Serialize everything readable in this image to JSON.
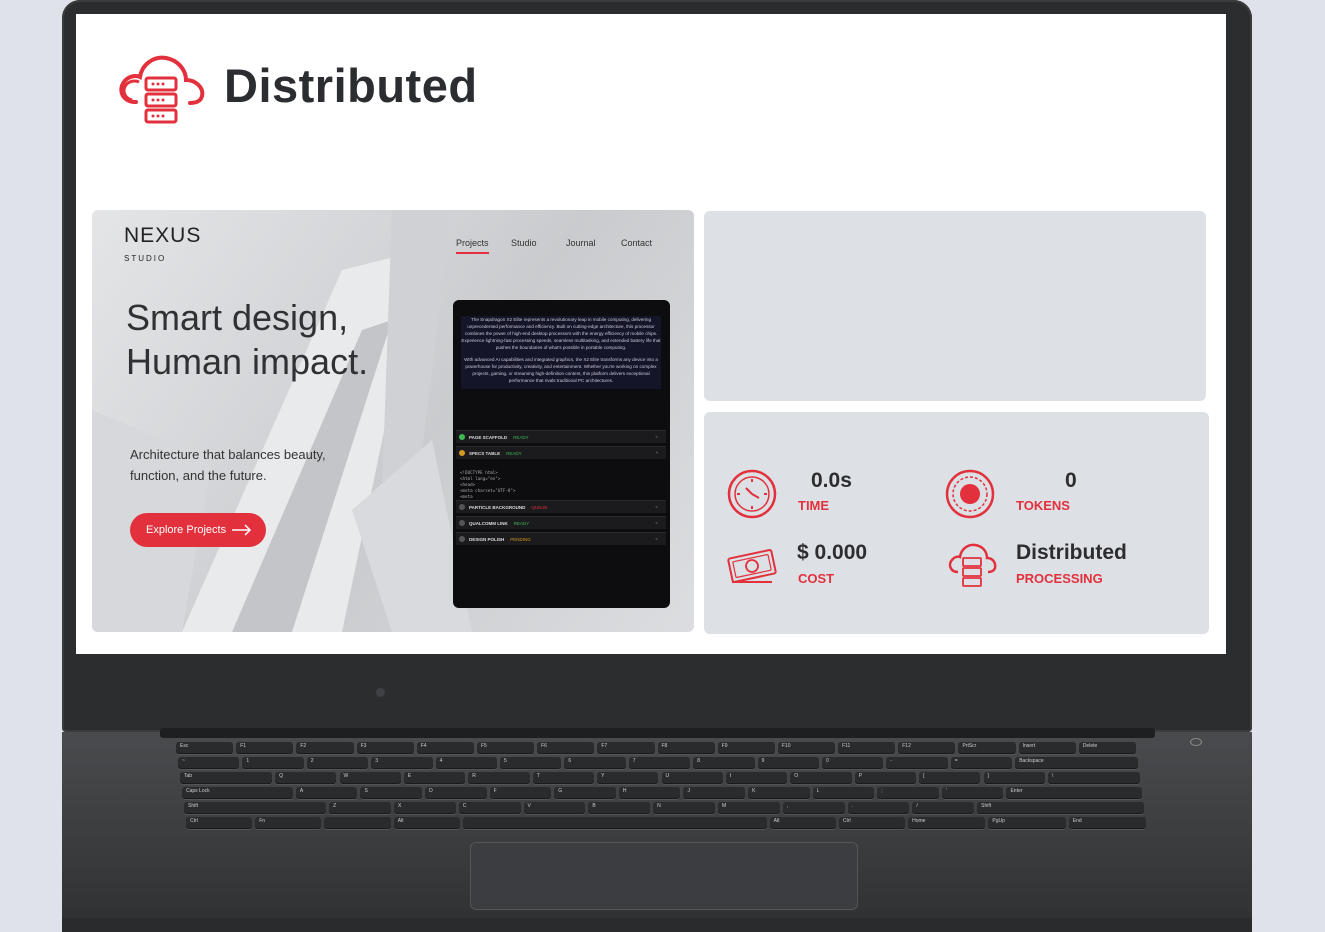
{
  "header": {
    "title": "Distributed",
    "icon": "cloud-server-icon"
  },
  "preview": {
    "brand_name": "NEXUS",
    "brand_sub": "STUDIO",
    "nav": [
      "Projects",
      "Studio",
      "Journal",
      "Contact"
    ],
    "active_nav": "Projects",
    "hero_line1": "Smart design,",
    "hero_line2": "Human impact.",
    "tagline": "Architecture that balances beauty, function, and the future.",
    "cta_label": "Explore Projects",
    "mock": {
      "para1": "The Snapdragon X2 Elite represents a revolutionary leap in mobile computing, delivering unprecedented performance and efficiency. Built on cutting-edge architecture, this processor combines the power of high-end desktop processors with the energy efficiency of mobile chips. Experience lightning-fast processing speeds, seamless multitasking, and extended battery life that pushes the boundaries of what's possible in portable computing.",
      "para2": "With advanced AI capabilities and integrated graphics, the X2 Elite transforms any device into a powerhouse for productivity, creativity, and entertainment. Whether you're working on complex projects, gaming, or streaming high-definition content, this platform delivers exceptional performance that rivals traditional PC architectures.",
      "rows": [
        {
          "label": "PAGE SCAFFOLD",
          "status": "READY",
          "status_color": "#3fb950",
          "dot": "#3fb950"
        },
        {
          "label": "SPECS TABLE",
          "status": "READY",
          "status_color": "#3fb950",
          "dot": "#d29922"
        },
        {
          "label": "PARTICLE BACKGROUND",
          "status": "QUEUE",
          "status_color": "#e2313c",
          "dot": "#555555"
        },
        {
          "label": "QUALCOMM LINK",
          "status": "READY",
          "status_color": "#3fb950",
          "dot": "#555555"
        },
        {
          "label": "DESIGN POLISH",
          "status": "PENDING",
          "status_color": "#d29922",
          "dot": "#555555"
        }
      ],
      "code": [
        "<!DOCTYPE html>",
        "<html lang=\"en\">",
        "<head>",
        "  <meta charset=\"UTF-8\">",
        "  <meta"
      ]
    }
  },
  "stats": {
    "time": {
      "value": "0.0s",
      "label": "TIME",
      "icon": "clock-icon"
    },
    "tokens": {
      "value": "0",
      "label": "TOKENS",
      "icon": "record-dot-icon"
    },
    "cost": {
      "value": "$ 0.000",
      "label": "COST",
      "icon": "money-icon"
    },
    "mode": {
      "value": "Distributed",
      "label": "PROCESSING",
      "icon": "cloud-server-icon"
    }
  },
  "colors": {
    "accent": "#e2313c",
    "text": "#2b2d31",
    "panel": "#dde0e5"
  },
  "keyboard": {
    "rows": [
      [
        "Esc",
        "F1",
        "F2",
        "F3",
        "F4",
        "F5",
        "F6",
        "F7",
        "F8",
        "F9",
        "F10",
        "F11",
        "F12",
        "PrtScr",
        "Insert",
        "Delete"
      ],
      [
        "~",
        "1",
        "2",
        "3",
        "4",
        "5",
        "6",
        "7",
        "8",
        "9",
        "0",
        "-",
        "=",
        "Backspace"
      ],
      [
        "Tab",
        "Q",
        "W",
        "E",
        "R",
        "T",
        "Y",
        "U",
        "I",
        "O",
        "P",
        "[",
        "]",
        "\\"
      ],
      [
        "Caps Lock",
        "A",
        "S",
        "D",
        "F",
        "G",
        "H",
        "J",
        "K",
        "L",
        ";",
        "'",
        "Enter"
      ],
      [
        "Shift",
        "Z",
        "X",
        "C",
        "V",
        "B",
        "N",
        "M",
        ",",
        ".",
        "/",
        "Shift"
      ],
      [
        "Ctrl",
        "Fn",
        "",
        "Alt",
        "",
        "Alt",
        "Ctrl",
        "Home",
        "PgUp",
        "End"
      ]
    ]
  }
}
